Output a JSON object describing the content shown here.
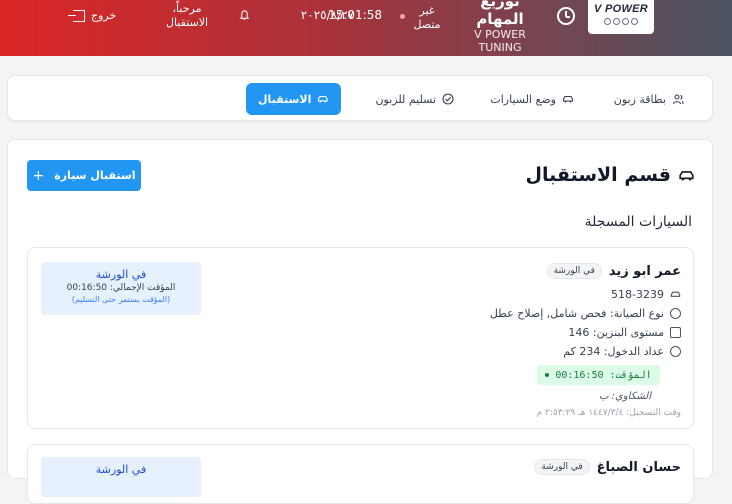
{
  "header": {
    "logo_text": "V POWER",
    "app_title": "توزيع المهام",
    "app_subtitle": "V POWER TUNING",
    "status": "غير متصل",
    "time": "15:01:58",
    "date": "٢٠٢٥/٨/٢٧",
    "welcome": "مرحباً، الاستقبال",
    "logout": "خروج"
  },
  "nav": {
    "tabs": [
      {
        "label": "بطاقة زبون",
        "icon": "users-icon"
      },
      {
        "label": "وضع السيارات",
        "icon": "car-icon"
      },
      {
        "label": "تسليم للزبون",
        "icon": "check-circle-icon"
      },
      {
        "label": "الاستقبال",
        "icon": "car-icon",
        "active": true
      }
    ]
  },
  "main": {
    "title": "قسم الاستقبال",
    "add_button": "استقبال سيارة",
    "subtitle": "السيارات المسجلة",
    "cars": [
      {
        "customer": "عمر ابو زيد",
        "badge": "في الورشة",
        "plate": "518-3239",
        "service": "نوع الصيانة: فحص شامل, إصلاح عطل",
        "fuel": "مستوى البنزين: 146",
        "odometer": "عداد الدخول: 234 كم",
        "timer": "المؤقت: 00:16:50",
        "complaints": "الشكاوي: ب",
        "registered": "وقت التسجيل: ١٤٤٧/٣/٤ هـ ٢:٥٣:٢٩ م",
        "ws_status": "في الورشة",
        "ws_total": "المؤقت الإجمالي: 00:16:50",
        "ws_note": "(المؤقت يستمر حتى التسليم)"
      },
      {
        "customer": "حسان الصباغ",
        "badge": "في الورشة",
        "ws_status": "في الورشة"
      }
    ]
  },
  "colors": {
    "accent": "#2196f3",
    "header_red": "#dc2626",
    "header_gray": "#4b5563",
    "timer_bg": "#dcfce7"
  }
}
